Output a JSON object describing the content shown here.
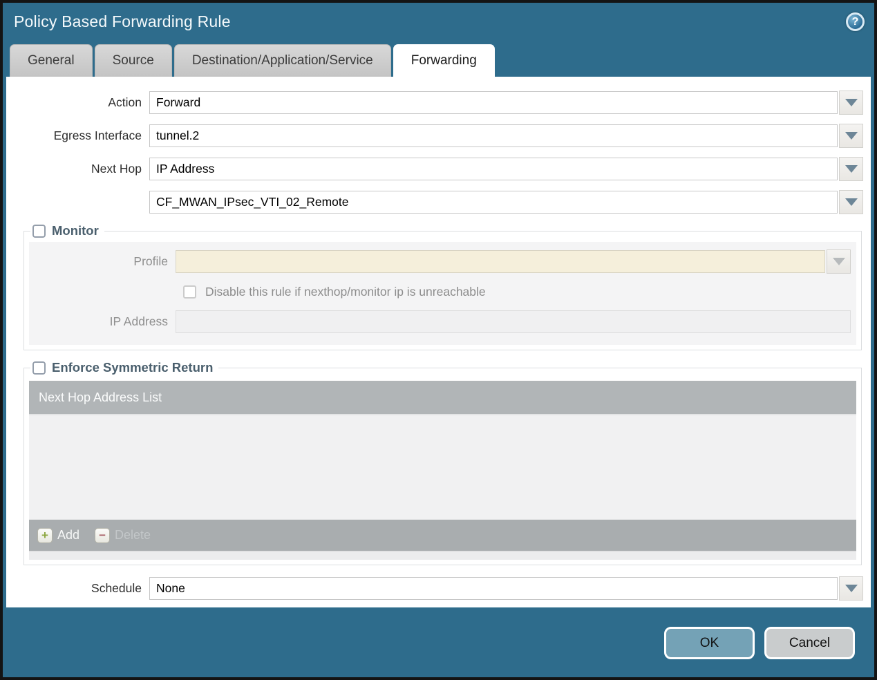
{
  "window": {
    "title": "Policy Based Forwarding Rule",
    "help_icon": "?"
  },
  "tabs": [
    {
      "label": "General",
      "active": false
    },
    {
      "label": "Source",
      "active": false
    },
    {
      "label": "Destination/Application/Service",
      "active": false
    },
    {
      "label": "Forwarding",
      "active": true
    }
  ],
  "form": {
    "action": {
      "label": "Action",
      "value": "Forward"
    },
    "egress_interface": {
      "label": "Egress Interface",
      "value": "tunnel.2"
    },
    "next_hop": {
      "label": "Next Hop",
      "value": "IP Address"
    },
    "next_hop_address": {
      "value": "CF_MWAN_IPsec_VTI_02_Remote"
    },
    "schedule": {
      "label": "Schedule",
      "value": "None"
    }
  },
  "monitor": {
    "title": "Monitor",
    "checked": false,
    "profile": {
      "label": "Profile",
      "value": ""
    },
    "disable_rule": {
      "label": "Disable this rule if nexthop/monitor ip is unreachable",
      "checked": false
    },
    "ip_address": {
      "label": "IP Address",
      "value": ""
    }
  },
  "enforce_symmetric_return": {
    "title": "Enforce Symmetric Return",
    "checked": false,
    "table": {
      "header": "Next Hop Address List",
      "rows": []
    },
    "buttons": {
      "add": "Add",
      "delete": "Delete"
    }
  },
  "footer": {
    "ok": "OK",
    "cancel": "Cancel"
  },
  "colors": {
    "dialog_background": "#2e6c8c",
    "header_text": "#f4f9fb",
    "active_tab": "#ffffff",
    "inactive_tab": "#c9c9c9",
    "section_title": "#4a5f6d",
    "disabled_input_tan": "#f5efdb",
    "disabled_panel": "#f4f4f5",
    "table_header": "#b1b5b7",
    "table_footer": "#a9adaf",
    "ok_button": "#74a2b6",
    "cancel_button": "#c9cccd",
    "add_plus": "#8ca73f",
    "delete_minus": "#a85f66"
  }
}
